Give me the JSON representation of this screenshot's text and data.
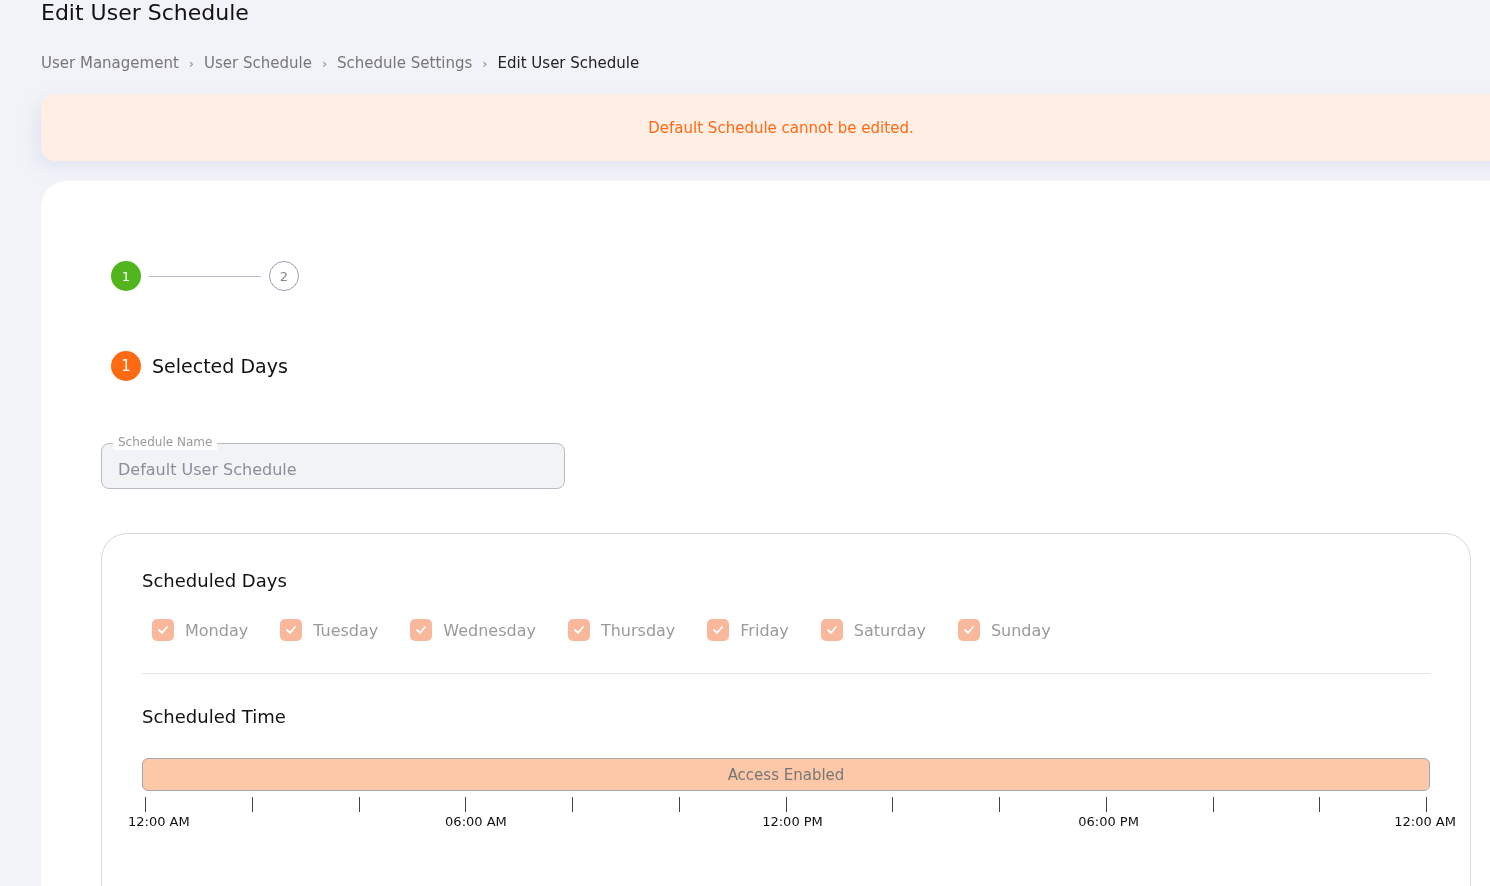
{
  "page_title": "Edit User Schedule",
  "breadcrumb": [
    {
      "label": "User Management",
      "current": false
    },
    {
      "label": "User Schedule",
      "current": false
    },
    {
      "label": "Schedule Settings",
      "current": false
    },
    {
      "label": "Edit User Schedule",
      "current": true
    }
  ],
  "breadcrumb_separator": "›",
  "alert": {
    "message": "Default Schedule cannot be edited."
  },
  "stepper": [
    {
      "label": "1",
      "selected": true
    },
    {
      "label": "2",
      "selected": false
    }
  ],
  "section": {
    "number": "1",
    "title": "Selected Days"
  },
  "schedule_name": {
    "label": "Schedule Name",
    "value": "Default User Schedule",
    "disabled": true
  },
  "scheduled_days": {
    "title": "Scheduled Days",
    "days": [
      {
        "label": "Monday",
        "checked": true,
        "disabled": true
      },
      {
        "label": "Tuesday",
        "checked": true,
        "disabled": true
      },
      {
        "label": "Wednesday",
        "checked": true,
        "disabled": true
      },
      {
        "label": "Thursday",
        "checked": true,
        "disabled": true
      },
      {
        "label": "Friday",
        "checked": true,
        "disabled": true
      },
      {
        "label": "Saturday",
        "checked": true,
        "disabled": true
      },
      {
        "label": "Sunday",
        "checked": true,
        "disabled": true
      }
    ]
  },
  "scheduled_time": {
    "title": "Scheduled Time",
    "bar_label": "Access Enabled",
    "labels": [
      "12:00 AM",
      "06:00 AM",
      "12:00 PM",
      "06:00 PM",
      "12:00 AM"
    ]
  }
}
